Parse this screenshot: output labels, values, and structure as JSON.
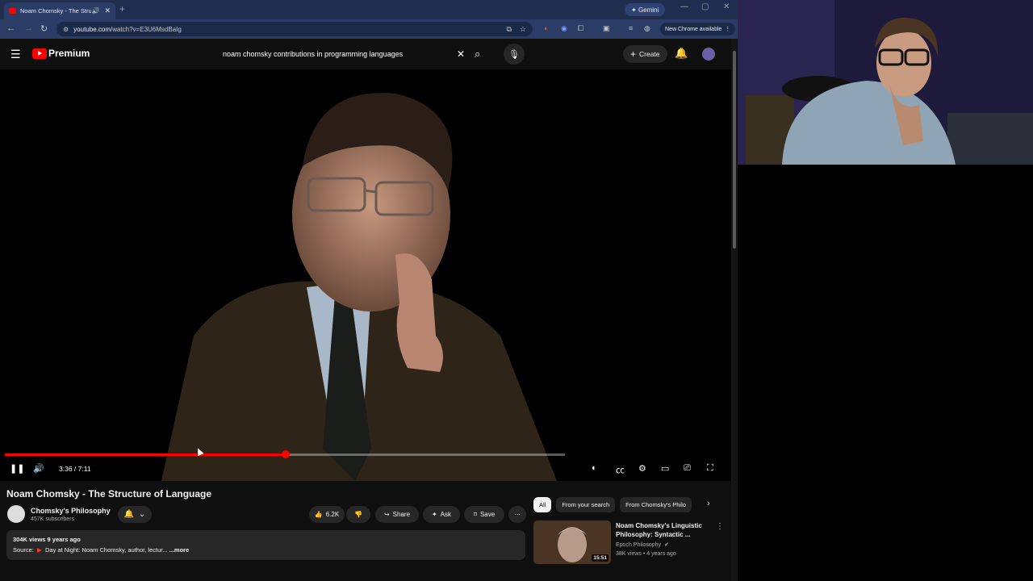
{
  "browser": {
    "tab_title": "Noam Chomsky - The Struc",
    "gemini_label": "Gemini",
    "url_host": "youtube.com",
    "url_path": "/watch?v=E3U6MsdBaIg",
    "update_label": "New Chrome available"
  },
  "header": {
    "logo_text": "Premium",
    "search_query": "noam chomsky contributions in programming languages",
    "create_label": "Create"
  },
  "player": {
    "time_current": "3:36",
    "time_total": "7:11",
    "time_display": "3:36 / 7:11",
    "progress_fraction": 0.501,
    "buffered_fraction": 0.78
  },
  "video": {
    "title": "Noam Chomsky - The Structure of Language",
    "channel": "Chomsky's Philosophy",
    "subscribers": "457K subscribers",
    "likes": "6.2K",
    "share_label": "Share",
    "ask_label": "Ask",
    "save_label": "Save",
    "description_meta": "304K views  9 years ago",
    "description_source_label": "Source:",
    "description_source_text": "Day at Night: Noam Chomsky, author, lectur...",
    "more_label": "...more"
  },
  "chips": [
    "All",
    "From your search",
    "From Chomsky's Philo"
  ],
  "recommendation": {
    "title": "Noam Chomsky's Linguistic Philosophy: Syntactic ...",
    "channel": "Epoch Philosophy",
    "views": "38K views • 4 years ago",
    "duration": "15:51"
  },
  "colors": {
    "yt_red": "#ff0000",
    "chrome_frame": "#1f2d4f",
    "yt_bg": "#0f0f0f",
    "pill_bg": "#272727"
  }
}
